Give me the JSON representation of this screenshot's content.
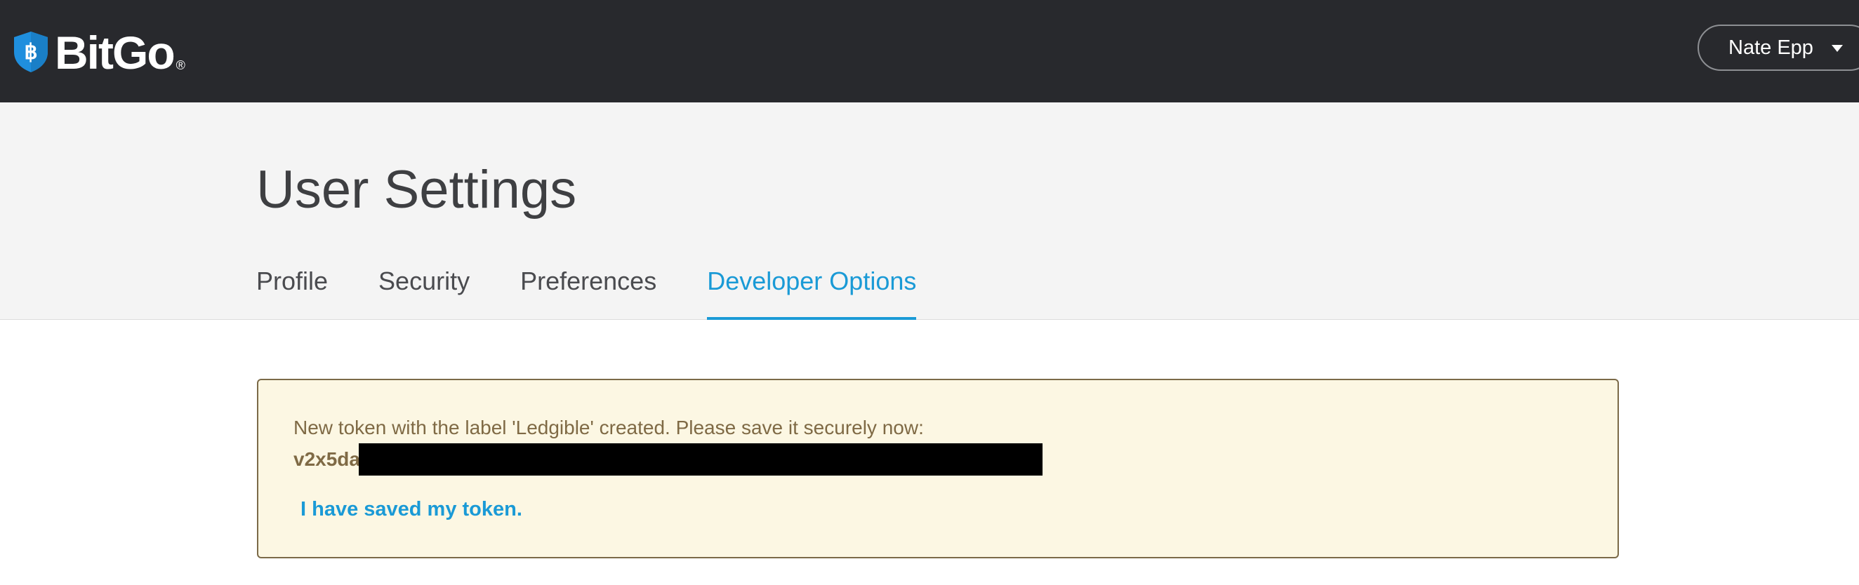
{
  "navbar": {
    "brand_name": "BitGo",
    "brand_registered_mark": "®",
    "brand_icon": "bitcoin-shield-icon",
    "user_name": "Nate Epp",
    "user_menu_icon": "caret-down-icon"
  },
  "settings": {
    "title": "User Settings",
    "tabs": [
      {
        "label": "Profile",
        "active": false
      },
      {
        "label": "Security",
        "active": false
      },
      {
        "label": "Preferences",
        "active": false
      },
      {
        "label": "Developer Options",
        "active": true
      }
    ]
  },
  "alert": {
    "message": "New token with the label 'Ledgible' created. Please save it securely now:",
    "token_visible_prefix": "v2x5da",
    "confirm_link": "I have saved my token."
  },
  "colors": {
    "navbar_bg": "#28292d",
    "header_band_bg": "#f4f4f4",
    "accent_blue": "#1a9ad6",
    "brand_blue": "#1f8fde",
    "alert_bg": "#fcf7e3",
    "alert_border": "#7b6a48",
    "alert_text": "#7f6a45"
  }
}
